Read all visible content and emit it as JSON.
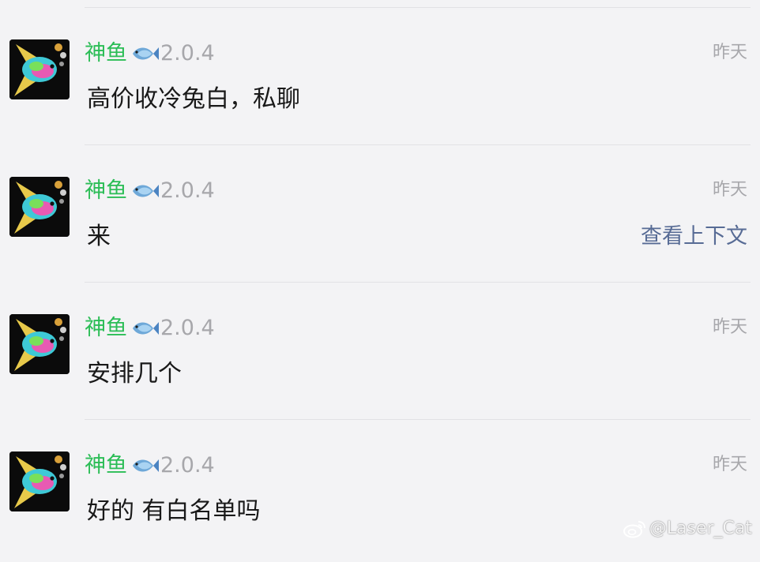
{
  "messages": [
    {
      "sender_name": "神鱼",
      "sender_emoji": "fish-icon",
      "sender_version": "2.0.4",
      "time": "昨天",
      "text": "高价收冷兔白，私聊",
      "context_link": ""
    },
    {
      "sender_name": "神鱼",
      "sender_emoji": "fish-icon",
      "sender_version": "2.0.4",
      "time": "昨天",
      "text": "来",
      "context_link": "查看上下文"
    },
    {
      "sender_name": "神鱼",
      "sender_emoji": "fish-icon",
      "sender_version": "2.0.4",
      "time": "昨天",
      "text": "安排几个",
      "context_link": ""
    },
    {
      "sender_name": "神鱼",
      "sender_emoji": "fish-icon",
      "sender_version": "2.0.4",
      "time": "昨天",
      "text": "好的 有白名单吗",
      "context_link": ""
    }
  ],
  "watermark": {
    "text": "@Laser_Cat",
    "icon": "weibo-icon"
  },
  "colors": {
    "background": "#f3f3f5",
    "sender_name": "#2bbd56",
    "muted": "#a7a7ab",
    "link": "#576b95",
    "message_text": "#191919"
  }
}
